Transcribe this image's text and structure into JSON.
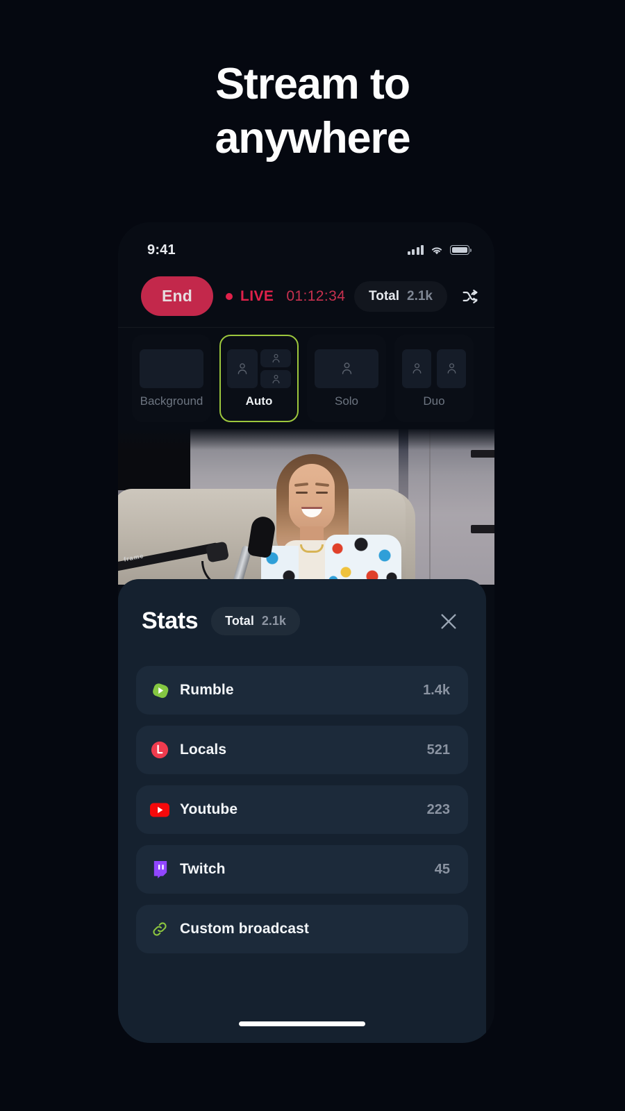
{
  "headline": {
    "line1": "Stream to",
    "line2": "anywhere"
  },
  "status_bar": {
    "time": "9:41",
    "icons": [
      "cellular-signal-icon",
      "wifi-icon",
      "battery-icon"
    ]
  },
  "topbar": {
    "end_label": "End",
    "live_label": "LIVE",
    "elapsed": "01:12:34",
    "total_label": "Total",
    "total_value": "2.1k",
    "shuffle_icon": "shuffle-icon"
  },
  "layouts": {
    "items": [
      {
        "label": "Background",
        "selected": false
      },
      {
        "label": "Auto",
        "selected": true
      },
      {
        "label": "Solo",
        "selected": false
      },
      {
        "label": "Duo",
        "selected": false
      }
    ],
    "selected_color": "#9dc73d"
  },
  "stats": {
    "title": "Stats",
    "total_label": "Total",
    "total_value": "2.1k",
    "close_icon": "close-icon",
    "rows": [
      {
        "name": "Rumble",
        "count": "1.4k",
        "icon": "rumble-icon",
        "color": "#85c742"
      },
      {
        "name": "Locals",
        "count": "521",
        "icon": "locals-icon",
        "color": "#ef3b4e"
      },
      {
        "name": "Youtube",
        "count": "223",
        "icon": "youtube-icon",
        "color": "#f5090b"
      },
      {
        "name": "Twitch",
        "count": "45",
        "icon": "twitch-icon",
        "color": "#9146ff"
      },
      {
        "name": "Custom broadcast",
        "count": "",
        "icon": "link-icon",
        "color": "#8cc63f"
      }
    ]
  },
  "colors": {
    "page_background": "#050810",
    "phone_background": "#080c14",
    "sheet_background": "#15212f",
    "row_background": "#1c2a3a",
    "end_button": "#c3284b",
    "live_red": "#e0214a",
    "accent_green": "#9dc73d"
  }
}
